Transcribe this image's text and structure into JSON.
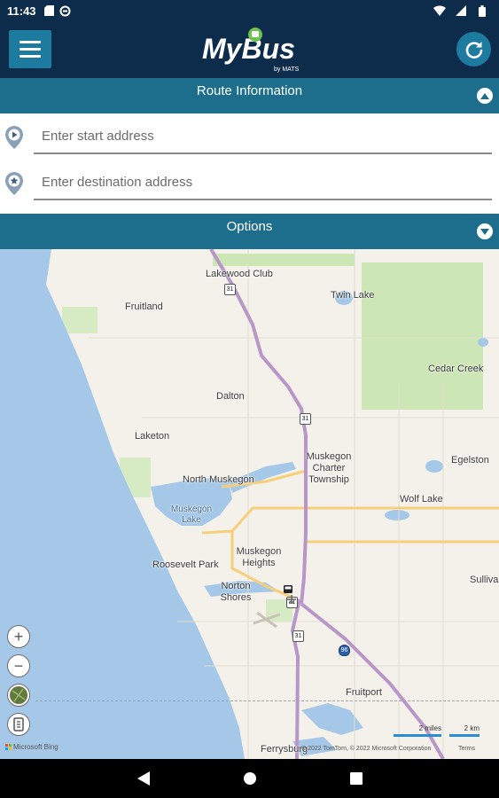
{
  "status_bar": {
    "time": "11:43",
    "icons": [
      "sd-card-icon",
      "sync-icon",
      "wifi-icon",
      "signal-icon",
      "battery-icon"
    ]
  },
  "app_bar": {
    "logo_main": "MyBus",
    "logo_sub": "by MATS",
    "menu_icon": "hamburger-menu-icon",
    "refresh_icon": "refresh-icon",
    "colors": {
      "bar": "#0d2b4a",
      "button": "#1e7ba0",
      "logo_accent": "#6cc24a"
    }
  },
  "route_section": {
    "title": "Route Information",
    "toggle_icon": "chevron-up-icon",
    "start": {
      "placeholder": "Enter start address",
      "value": ""
    },
    "destination": {
      "placeholder": "Enter destination address",
      "value": ""
    }
  },
  "options_section": {
    "title": "Options",
    "toggle_icon": "chevron-down-icon"
  },
  "map": {
    "places": [
      "Lakewood Club",
      "Twin Lake",
      "Fruitland",
      "Cedar Creek",
      "Dalton",
      "Laketon",
      "Muskegon Charter Township",
      "Egelston",
      "North Muskegon",
      "Wolf Lake",
      "Muskegon Lake",
      "Muskegon Heights",
      "Roosevelt Park",
      "Norton Shores",
      "Sulliva",
      "Fruitport",
      "Ferrysburg"
    ],
    "route_shields": [
      "31",
      "31",
      "31",
      "31",
      "96"
    ],
    "controls": [
      "zoom-in-icon",
      "zoom-out-icon",
      "map-style-icon",
      "layers-icon"
    ],
    "attribution_logo": "Microsoft Bing",
    "copyright": "© 2022 TomTom, © 2022 Microsoft Corporation",
    "terms": "Terms",
    "scale_miles": "2 miles",
    "scale_km": "2 km",
    "colors": {
      "water": "#a5c8e8",
      "land": "#f4f1ea",
      "park": "#cde6b5",
      "highway": "#b896c8",
      "major_road": "#f5cf7a"
    }
  },
  "nav_bar": {
    "buttons": [
      "back-icon",
      "home-icon",
      "recents-icon"
    ]
  }
}
